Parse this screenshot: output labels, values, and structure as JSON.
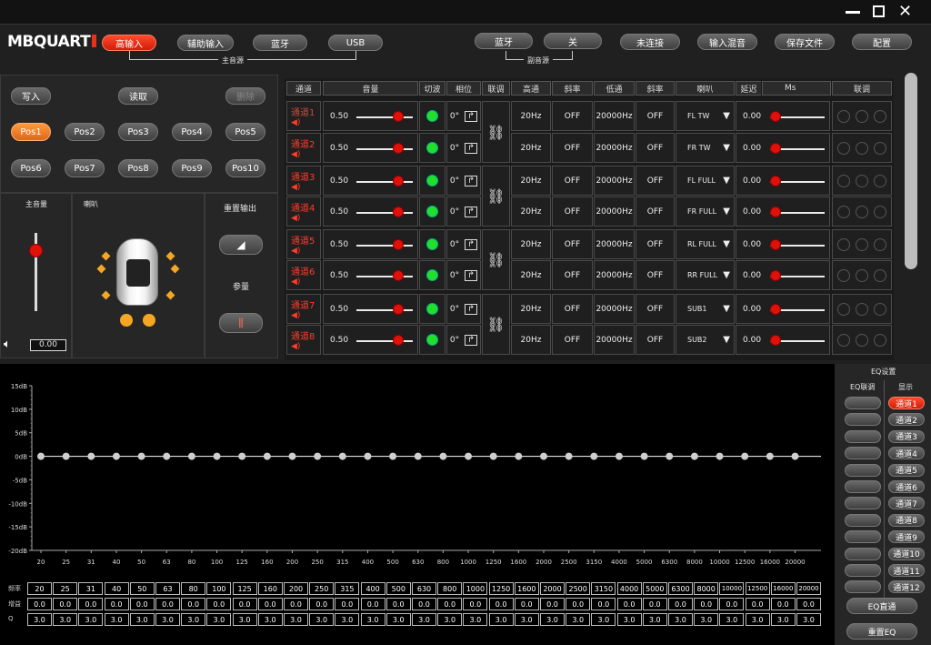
{
  "window": {
    "logo": "MBQUART"
  },
  "main_sources": [
    "高输入",
    "辅助输入",
    "蓝牙",
    "USB"
  ],
  "main_source_label": "主音源",
  "sub_sources": [
    "蓝牙",
    "关"
  ],
  "sub_source_label": "副音源",
  "top_actions": [
    "未连接",
    "输入混音",
    "保存文件",
    "配置"
  ],
  "preset": {
    "write": "写入",
    "read": "读取",
    "delete": "删除",
    "positions": [
      "Pos1",
      "Pos2",
      "Pos3",
      "Pos4",
      "Pos5",
      "Pos6",
      "Pos7",
      "Pos8",
      "Pos9",
      "Pos10"
    ]
  },
  "master": {
    "title": "主音量",
    "value": "0.00",
    "level": 0.78
  },
  "speaker_panel": {
    "title": "喇叭"
  },
  "reset_panel": {
    "title": "重置输出",
    "param_label": "参量"
  },
  "table": {
    "headers": [
      "通道",
      "音量",
      "切波",
      "相位",
      "联调",
      "高通",
      "斜率",
      "低通",
      "斜率",
      "喇叭",
      "延迟",
      "Ms",
      "联调"
    ],
    "rows": [
      {
        "name": "通道1",
        "volume": "0.50",
        "phase": "0°",
        "hp": "20Hz",
        "hs": "OFF",
        "lp": "20000Hz",
        "ls": "OFF",
        "speaker": "FL TW",
        "delay": "0.00",
        "active": false
      },
      {
        "name": "通道2",
        "volume": "0.50",
        "phase": "0°",
        "hp": "20Hz",
        "hs": "OFF",
        "lp": "20000Hz",
        "ls": "OFF",
        "speaker": "FR TW",
        "delay": "0.00",
        "active": true
      },
      {
        "name": "通道3",
        "volume": "0.50",
        "phase": "0°",
        "hp": "20Hz",
        "hs": "OFF",
        "lp": "20000Hz",
        "ls": "OFF",
        "speaker": "FL FULL",
        "delay": "0.00",
        "active": true
      },
      {
        "name": "通道4",
        "volume": "0.50",
        "phase": "0°",
        "hp": "20Hz",
        "hs": "OFF",
        "lp": "20000Hz",
        "ls": "OFF",
        "speaker": "FR FULL",
        "delay": "0.00",
        "active": true
      },
      {
        "name": "通道5",
        "volume": "0.50",
        "phase": "0°",
        "hp": "20Hz",
        "hs": "OFF",
        "lp": "20000Hz",
        "ls": "OFF",
        "speaker": "RL FULL",
        "delay": "0.00",
        "active": true
      },
      {
        "name": "通道6",
        "volume": "0.50",
        "phase": "0°",
        "hp": "20Hz",
        "hs": "OFF",
        "lp": "20000Hz",
        "ls": "OFF",
        "speaker": "RR FULL",
        "delay": "0.00",
        "active": true
      },
      {
        "name": "通道7",
        "volume": "0.50",
        "phase": "0°",
        "hp": "20Hz",
        "hs": "OFF",
        "lp": "20000Hz",
        "ls": "OFF",
        "speaker": "SUB1",
        "delay": "0.00",
        "active": true
      },
      {
        "name": "通道8",
        "volume": "0.50",
        "phase": "0°",
        "hp": "20Hz",
        "hs": "OFF",
        "lp": "20000Hz",
        "ls": "OFF",
        "speaker": "SUB2",
        "delay": "0.00",
        "active": true
      }
    ]
  },
  "eq_side": {
    "title": "EQ设置",
    "link_label": "EQ联调",
    "show_label": "显示",
    "channels": [
      "通道1",
      "通道2",
      "通道3",
      "通道4",
      "通道5",
      "通道6",
      "通道7",
      "通道8",
      "通道9",
      "通道10",
      "通道11",
      "通道12"
    ],
    "eq_direct": "EQ直通",
    "reset_eq": "重置EQ"
  },
  "eq_table": {
    "row_labels": [
      "频率",
      "增益",
      "Q"
    ]
  },
  "chart_data": {
    "type": "line",
    "ylabel_ticks": [
      "15dB",
      "10dB",
      "5dB",
      "0dB",
      "-5dB",
      "-10dB",
      "-15dB",
      "-20dB"
    ],
    "ylim": [
      -20,
      15
    ],
    "x": [
      "20",
      "25",
      "31",
      "40",
      "50",
      "63",
      "80",
      "100",
      "125",
      "160",
      "200",
      "250",
      "315",
      "400",
      "500",
      "630",
      "800",
      "1000",
      "1250",
      "1600",
      "2000",
      "2500",
      "3150",
      "4000",
      "5000",
      "6300",
      "8000",
      "10000",
      "12500",
      "16000",
      "20000"
    ],
    "series": [
      {
        "values": [
          0,
          0,
          0,
          0,
          0,
          0,
          0,
          0,
          0,
          0,
          0,
          0,
          0,
          0,
          0,
          0,
          0,
          0,
          0,
          0,
          0,
          0,
          0,
          0,
          0,
          0,
          0,
          0,
          0,
          0,
          0
        ]
      }
    ],
    "q": [
      "3.0",
      "3.0",
      "3.0",
      "3.0",
      "3.0",
      "3.0",
      "3.0",
      "3.0",
      "3.0",
      "3.0",
      "3.0",
      "3.0",
      "3.0",
      "3.0",
      "3.0",
      "3.0",
      "3.0",
      "3.0",
      "3.0",
      "3.0",
      "3.0",
      "3.0",
      "3.0",
      "3.0",
      "3.0",
      "3.0",
      "3.0",
      "3.0",
      "3.0",
      "3.0",
      "3.0"
    ],
    "gain_labels": [
      "0.0",
      "0.0",
      "0.0",
      "0.0",
      "0.0",
      "0.0",
      "0.0",
      "0.0",
      "0.0",
      "0.0",
      "0.0",
      "0.0",
      "0.0",
      "0.0",
      "0.0",
      "0.0",
      "0.0",
      "0.0",
      "0.0",
      "0.0",
      "0.0",
      "0.0",
      "0.0",
      "0.0",
      "0.0",
      "0.0",
      "0.0",
      "0.0",
      "0.0",
      "0.0",
      "0.0"
    ],
    "grid": false
  },
  "colors": {
    "accent": "#e8311b",
    "green": "#22e02a"
  }
}
